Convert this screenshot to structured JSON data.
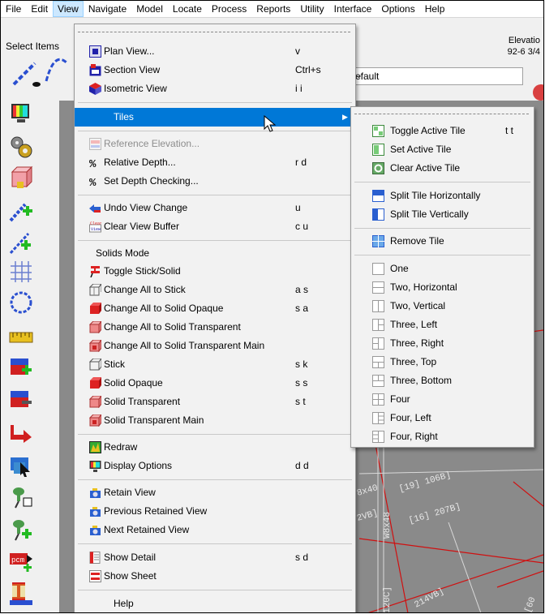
{
  "menubar": {
    "items": [
      "File",
      "Edit",
      "View",
      "Navigate",
      "Model",
      "Locate",
      "Process",
      "Reports",
      "Utility",
      "Interface",
      "Options",
      "Help"
    ]
  },
  "toolbar": {
    "select_items": "Select Items",
    "elevation_line1": "Elevatio",
    "elevation_line2": "92-6 3/4",
    "view_combo": "efault"
  },
  "view_menu": {
    "plan_view": {
      "label": "Plan View...",
      "shortcut": "v"
    },
    "section_view": {
      "label": "Section View",
      "shortcut": "Ctrl+s"
    },
    "isometric_view": {
      "label": "Isometric View",
      "shortcut": "i i"
    },
    "tiles": {
      "label": "Tiles"
    },
    "reference_elevation": {
      "label": "Reference Elevation..."
    },
    "relative_depth": {
      "label": "Relative Depth...",
      "shortcut": "r d"
    },
    "set_depth_checking": {
      "label": "Set Depth Checking..."
    },
    "undo_view_change": {
      "label": "Undo View Change",
      "shortcut": "u"
    },
    "clear_view_buffer": {
      "label": "Clear View Buffer",
      "shortcut": "c u"
    },
    "solids_mode": {
      "label": "Solids Mode"
    },
    "toggle_stick_solid": {
      "label": "Toggle Stick/Solid"
    },
    "change_all_stick": {
      "label": "Change All to Stick",
      "shortcut": "a s"
    },
    "change_all_solid_opaque": {
      "label": "Change All to Solid Opaque",
      "shortcut": "s a"
    },
    "change_all_solid_transparent": {
      "label": "Change All to Solid Transparent"
    },
    "change_all_solid_transparent_main": {
      "label": "Change All to Solid Transparent Main"
    },
    "stick": {
      "label": "Stick",
      "shortcut": "s k"
    },
    "solid_opaque": {
      "label": "Solid Opaque",
      "shortcut": "s s"
    },
    "solid_transparent": {
      "label": "Solid Transparent",
      "shortcut": "s t"
    },
    "solid_transparent_main": {
      "label": "Solid Transparent Main"
    },
    "redraw": {
      "label": "Redraw"
    },
    "display_options": {
      "label": "Display Options",
      "shortcut": "d d"
    },
    "retain_view": {
      "label": "Retain View"
    },
    "previous_retained_view": {
      "label": "Previous Retained View"
    },
    "next_retained_view": {
      "label": "Next Retained View"
    },
    "show_detail": {
      "label": "Show Detail",
      "shortcut": "s d"
    },
    "show_sheet": {
      "label": "Show Sheet"
    },
    "help": {
      "label": "Help"
    }
  },
  "tiles_menu": {
    "toggle_active_tile": {
      "label": "Toggle Active Tile",
      "shortcut": "t t"
    },
    "set_active_tile": {
      "label": "Set Active Tile"
    },
    "clear_active_tile": {
      "label": "Clear Active Tile"
    },
    "split_horizontally": {
      "label": "Split Tile Horizontally"
    },
    "split_vertically": {
      "label": "Split Tile Vertically"
    },
    "remove_tile": {
      "label": "Remove Tile"
    },
    "one": {
      "label": "One"
    },
    "two_horizontal": {
      "label": "Two, Horizontal"
    },
    "two_vertical": {
      "label": "Two, Vertical"
    },
    "three_left": {
      "label": "Three, Left"
    },
    "three_right": {
      "label": "Three, Right"
    },
    "three_top": {
      "label": "Three, Top"
    },
    "three_bottom": {
      "label": "Three, Bottom"
    },
    "four": {
      "label": "Four"
    },
    "four_left": {
      "label": "Four, Left"
    },
    "four_right": {
      "label": "Four, Right"
    }
  },
  "canvas_labels": [
    "[19] 106B]",
    "[16] 207B]",
    "8x40",
    "2VB]",
    "W8x48",
    "120C]",
    "214VB]",
    "[60"
  ],
  "colors": {
    "highlight": "#0078d7",
    "canvas": "#8a8a8a",
    "member_line": "#d01010"
  }
}
